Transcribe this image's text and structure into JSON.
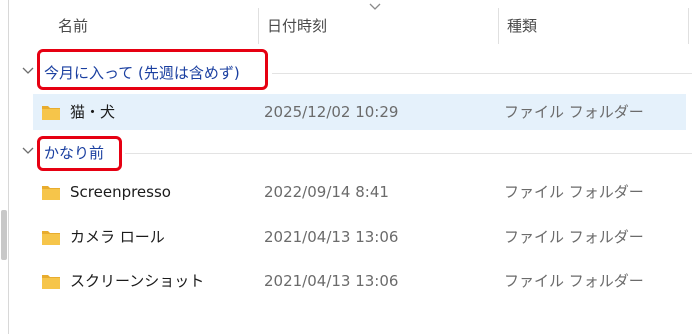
{
  "header": {
    "name_label": "名前",
    "date_label": "日付時刻",
    "type_label": "種類"
  },
  "groups": [
    {
      "label": "今月に入って (先週は含めず)",
      "items": [
        {
          "name": "猫・犬",
          "date": "2025/12/02 10:29",
          "type": "ファイル フォルダー",
          "selected": true
        }
      ]
    },
    {
      "label": "かなり前",
      "items": [
        {
          "name": "Screenpresso",
          "date": "2022/09/14 8:41",
          "type": "ファイル フォルダー"
        },
        {
          "name": "カメラ ロール",
          "date": "2021/04/13 13:06",
          "type": "ファイル フォルダー"
        },
        {
          "name": "スクリーンショット",
          "date": "2021/04/13 13:06",
          "type": "ファイル フォルダー"
        }
      ]
    }
  ],
  "colors": {
    "group_label": "#1a3fa0",
    "highlight_box": "#e60012",
    "selected_row": "#e5f1fb",
    "folder": "#f6c54a"
  },
  "icons": {
    "folder": "folder-icon",
    "group_toggle": "chevron-down-icon",
    "sort_indicator": "chevron-down-icon"
  }
}
